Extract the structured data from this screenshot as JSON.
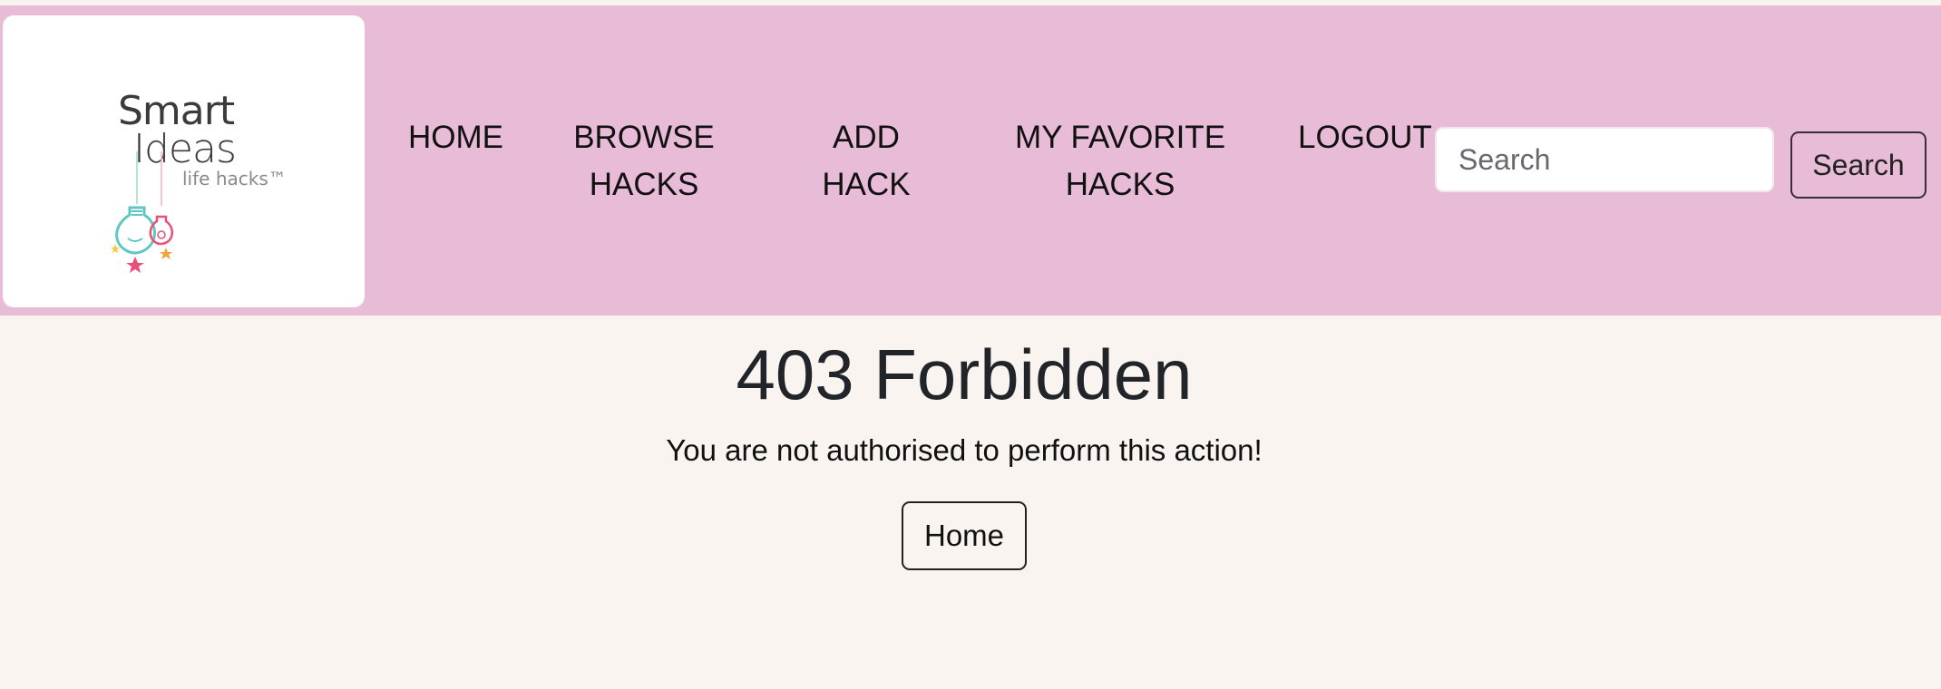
{
  "logo": {
    "line1": "Smart",
    "line2": "Ideas",
    "line3": "life hacks™"
  },
  "nav": {
    "home": "HOME",
    "browse_line1": "BROWSE",
    "browse_line2": "HACKS",
    "add_line1": "ADD",
    "add_line2": "HACK",
    "favorites_line1": "MY FAVORITE",
    "favorites_line2": "HACKS",
    "logout": "LOGOUT"
  },
  "search": {
    "placeholder": "Search",
    "button_label": "Search"
  },
  "main": {
    "title": "403 Forbidden",
    "message": "You are not authorised to perform this action!",
    "home_button": "Home"
  },
  "colors": {
    "navbar_bg": "#e8bbd6",
    "page_bg": "#faf4f1"
  }
}
